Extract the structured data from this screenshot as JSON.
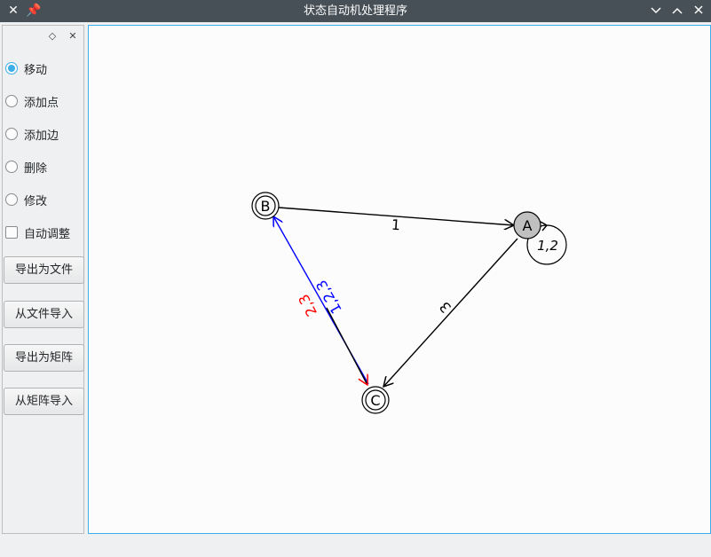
{
  "window": {
    "title": "状态自动机处理程序",
    "left_icons": [
      "close-x-icon",
      "pin-icon"
    ],
    "right_controls": [
      "minimize-chevron-icon",
      "maximize-chevron-icon",
      "close-icon"
    ],
    "titlebar_color": "#475057"
  },
  "dock": {
    "controls": [
      "float-diamond-icon",
      "dock-close-icon"
    ],
    "modes": [
      {
        "label": "移动",
        "selected": true
      },
      {
        "label": "添加点",
        "selected": false
      },
      {
        "label": "添加边",
        "selected": false
      },
      {
        "label": "删除",
        "selected": false
      },
      {
        "label": "修改",
        "selected": false
      }
    ],
    "auto_adjust": {
      "label": "自动调整",
      "checked": false
    },
    "buttons": [
      {
        "label": "导出为文件"
      },
      {
        "label": "从文件导入"
      },
      {
        "label": "导出为矩阵"
      },
      {
        "label": "从矩阵导入"
      }
    ],
    "accent_color": "#3daee9"
  },
  "graph": {
    "nodes": [
      {
        "id": "A",
        "label": "A",
        "start": true,
        "accepting": false
      },
      {
        "id": "B",
        "label": "B",
        "start": false,
        "accepting": true
      },
      {
        "id": "C",
        "label": "C",
        "start": false,
        "accepting": true
      }
    ],
    "edges": [
      {
        "from": "B",
        "to": "A",
        "label": "1",
        "color": "#000000"
      },
      {
        "from": "A",
        "to": "A",
        "label": "1,2",
        "color": "#000000"
      },
      {
        "from": "A",
        "to": "C",
        "label": "3",
        "color": "#000000"
      },
      {
        "from": "C",
        "to": "B",
        "label": "1,2,3",
        "color": "#0000ff"
      },
      {
        "from": "B",
        "to": "C",
        "label": "2,3",
        "color": "#ff0000"
      }
    ],
    "start_node_fill": "#c0c0c0"
  }
}
